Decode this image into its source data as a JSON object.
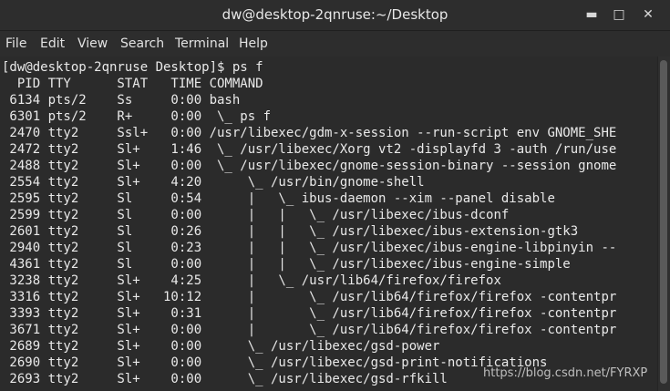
{
  "window": {
    "title": "dw@desktop-2qnruse:~/Desktop",
    "controls": {
      "minimize": "▬",
      "maximize": "□",
      "close": "✕"
    }
  },
  "menu": {
    "items": [
      "File",
      "Edit",
      "View",
      "Search",
      "Terminal",
      "Help"
    ]
  },
  "terminal": {
    "lines": [
      "[dw@desktop-2qnruse Desktop]$ ps f",
      "  PID TTY      STAT   TIME COMMAND",
      " 6134 pts/2    Ss     0:00 bash",
      " 6301 pts/2    R+     0:00  \\_ ps f",
      " 2470 tty2     Ssl+   0:00 /usr/libexec/gdm-x-session --run-script env GNOME_SHE",
      " 2472 tty2     Sl+    1:46  \\_ /usr/libexec/Xorg vt2 -displayfd 3 -auth /run/use",
      " 2488 tty2     Sl+    0:00  \\_ /usr/libexec/gnome-session-binary --session gnome",
      " 2554 tty2     Sl+    4:20      \\_ /usr/bin/gnome-shell",
      " 2595 tty2     Sl     0:54      |   \\_ ibus-daemon --xim --panel disable",
      " 2599 tty2     Sl     0:00      |   |   \\_ /usr/libexec/ibus-dconf",
      " 2601 tty2     Sl     0:26      |   |   \\_ /usr/libexec/ibus-extension-gtk3",
      " 2940 tty2     Sl     0:23      |   |   \\_ /usr/libexec/ibus-engine-libpinyin --",
      " 4361 tty2     Sl     0:00      |   |   \\_ /usr/libexec/ibus-engine-simple",
      " 3238 tty2     Sl+    4:25      |   \\_ /usr/lib64/firefox/firefox",
      " 3316 tty2     Sl+   10:12      |       \\_ /usr/lib64/firefox/firefox -contentpr",
      " 3393 tty2     Sl+    0:31      |       \\_ /usr/lib64/firefox/firefox -contentpr",
      " 3671 tty2     Sl+    0:00      |       \\_ /usr/lib64/firefox/firefox -contentpr",
      " 2689 tty2     Sl+    0:00      \\_ /usr/libexec/gsd-power",
      " 2690 tty2     Sl+    0:00      \\_ /usr/libexec/gsd-print-notifications",
      " 2693 tty2     Sl+    0:00      \\_ /usr/libexec/gsd-rfkill"
    ]
  },
  "watermark": "https://blog.csdn.net/FYRXP"
}
